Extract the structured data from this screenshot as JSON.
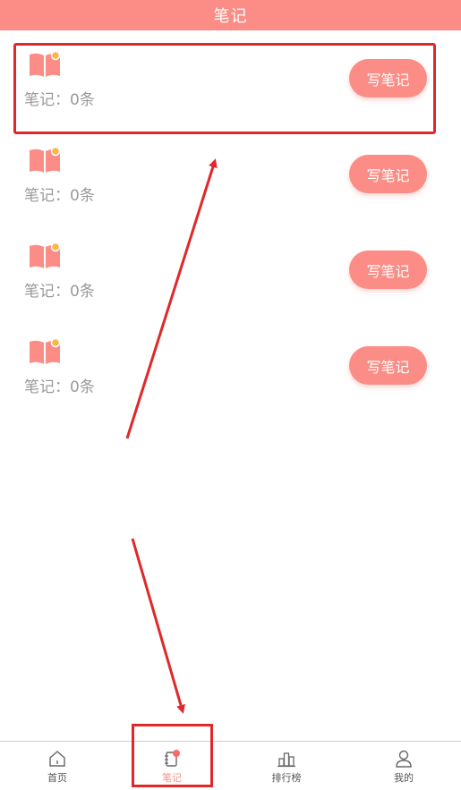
{
  "header": {
    "title": "笔记"
  },
  "notes": [
    {
      "count_label": "笔记：0条",
      "button_label": "写笔记",
      "icon": "open-book-icon"
    },
    {
      "count_label": "笔记：0条",
      "button_label": "写笔记",
      "icon": "open-book-icon"
    },
    {
      "count_label": "笔记：0条",
      "button_label": "写笔记",
      "icon": "open-book-icon"
    },
    {
      "count_label": "笔记：0条",
      "button_label": "写笔记",
      "icon": "open-book-icon"
    }
  ],
  "tabbar": {
    "tabs": [
      {
        "label": "首页",
        "icon": "home-icon",
        "active": false
      },
      {
        "label": "笔记",
        "icon": "notebook-icon",
        "active": true
      },
      {
        "label": "排行榜",
        "icon": "ranking-icon",
        "active": false
      },
      {
        "label": "我的",
        "icon": "user-icon",
        "active": false
      }
    ]
  },
  "colors": {
    "accent": "#fb8d86",
    "annotation": "#e0282a",
    "text_muted": "#9a9a9a"
  }
}
